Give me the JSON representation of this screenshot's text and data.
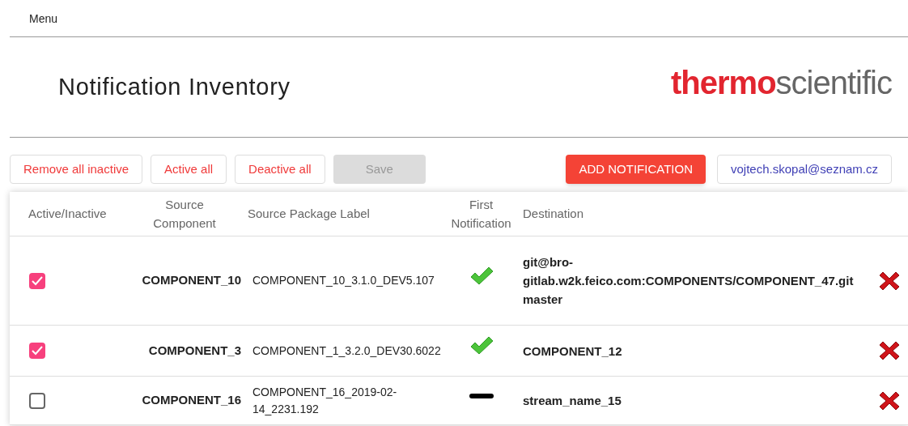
{
  "menu": {
    "label": "Menu"
  },
  "title": "Notification Inventory",
  "logo": {
    "primary": "thermo",
    "secondary": "scientific"
  },
  "toolbar": [
    {
      "label": "Remove all inactive",
      "kind": "outline",
      "disabled": false
    },
    {
      "label": "Active all",
      "kind": "outline",
      "disabled": false
    },
    {
      "label": "Deactive all",
      "kind": "outline",
      "disabled": false
    },
    {
      "label": "Save",
      "kind": "outline",
      "disabled": true
    }
  ],
  "add_button": "ADD NOTIFICATION",
  "user": "vojtech.skopal@seznam.cz",
  "table": {
    "columns": [
      "Active/Inactive",
      "Source Component",
      "Source Package Label",
      "First Notification",
      "Destination"
    ],
    "rows": [
      {
        "checked": true,
        "source_component": "COMPONENT_10",
        "package_label": "COMPONENT_10_3.1.0_DEV5.107",
        "first_notification": {
          "kind": "check"
        },
        "destination": "git@bro-gitlab.w2k.feico.com:COMPONENTS/COMPONENT_47.git master"
      },
      {
        "checked": true,
        "source_component": "COMPONENT_3",
        "package_label": "COMPONENT_1_3.2.0_DEV30.6022",
        "first_notification": {
          "kind": "check"
        },
        "destination": "COMPONENT_12"
      },
      {
        "checked": false,
        "source_component": "COMPONENT_16",
        "package_label": "COMPONENT_16_2019-02-14_2231.192",
        "first_notification": {
          "kind": "dash"
        },
        "destination": "stream_name_15"
      }
    ]
  }
}
